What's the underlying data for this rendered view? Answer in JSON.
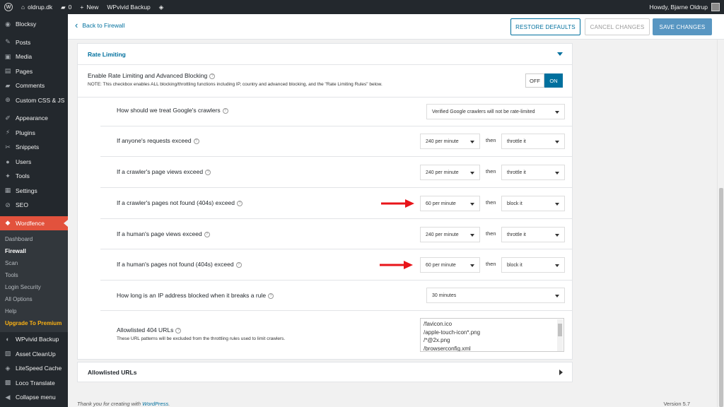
{
  "adminbar": {
    "site_name": "oldrup.dk",
    "comments_count": "0",
    "new_label": "New",
    "plugin_label": "WPvivid Backup",
    "howdy": "Howdy, Bjarne Oldrup"
  },
  "sidebar": {
    "items_top": [
      {
        "label": "Blocksy",
        "icon": "blocksy-icon"
      },
      {
        "label": "Posts",
        "icon": "pin-icon"
      },
      {
        "label": "Media",
        "icon": "media-icon"
      },
      {
        "label": "Pages",
        "icon": "pages-icon"
      },
      {
        "label": "Comments",
        "icon": "comment-icon"
      },
      {
        "label": "Custom CSS & JS",
        "icon": "plus-circle-icon"
      },
      {
        "label": "Appearance",
        "icon": "brush-icon"
      },
      {
        "label": "Plugins",
        "icon": "plug-icon"
      },
      {
        "label": "Snippets",
        "icon": "scissors-icon"
      },
      {
        "label": "Users",
        "icon": "user-icon"
      },
      {
        "label": "Tools",
        "icon": "wrench-icon"
      },
      {
        "label": "Settings",
        "icon": "sliders-icon"
      },
      {
        "label": "SEO",
        "icon": "seo-icon"
      }
    ],
    "active": {
      "label": "Wordfence",
      "icon": "wordfence-icon"
    },
    "submenu": [
      "Dashboard",
      "Firewall",
      "Scan",
      "Tools",
      "Login Security",
      "All Options",
      "Help",
      "Upgrade To Premium"
    ],
    "items_bottom": [
      {
        "label": "WPvivid Backup",
        "icon": "backup-icon"
      },
      {
        "label": "Asset CleanUp",
        "icon": "cleanup-icon"
      },
      {
        "label": "LiteSpeed Cache",
        "icon": "litespeed-icon"
      },
      {
        "label": "Loco Translate",
        "icon": "translate-icon"
      },
      {
        "label": "Collapse menu",
        "icon": "collapse-icon"
      }
    ]
  },
  "topbar": {
    "back_label": "Back to Firewall",
    "restore_label": "RESTORE DEFAULTS",
    "cancel_label": "CANCEL CHANGES",
    "save_label": "SAVE CHANGES"
  },
  "panel": {
    "title": "Rate Limiting",
    "enable_title": "Enable Rate Limiting and Advanced Blocking",
    "enable_note": "NOTE: This checkbox enables ALL blocking/throttling functions including IP, country and advanced blocking, and the \"Rate Limiting Rules\" below.",
    "toggle_off": "OFF",
    "toggle_on": "ON",
    "google_label": "How should we treat Google's crawlers",
    "google_value": "Verified Google crawlers will not be rate-limited",
    "then_label": "then",
    "rules": [
      {
        "label": "If anyone's requests exceed",
        "rate": "240 per minute",
        "action": "throttle it"
      },
      {
        "label": "If a crawler's page views exceed",
        "rate": "240 per minute",
        "action": "throttle it"
      },
      {
        "label": "If a crawler's pages not found (404s) exceed",
        "rate": "60 per minute",
        "action": "block it"
      },
      {
        "label": "If a human's page views exceed",
        "rate": "240 per minute",
        "action": "throttle it"
      },
      {
        "label": "If a human's pages not found (404s) exceed",
        "rate": "60 per minute",
        "action": "block it"
      }
    ],
    "block_duration_label": "How long is an IP address blocked when it breaks a rule",
    "block_duration_value": "30 minutes",
    "allowlisted_404_label": "Allowlisted 404 URLs",
    "allowlisted_404_note": "These URL patterns will be excluded from the throttling rules used to limit crawlers.",
    "allowlisted_404_lines": [
      "/favicon.ico",
      "/apple-touch-icon*.png",
      "/*@2x.png",
      "/browserconfig.xml"
    ]
  },
  "panel2": {
    "title": "Allowlisted URLs"
  },
  "footer": {
    "thanks": "Thank you for creating with",
    "wp_link": "WordPress",
    "version": "Version 5.7"
  },
  "colors": {
    "accent": "#00709e",
    "wordfence_red": "#e2523d",
    "arrow_red": "#e8141a",
    "save_blue": "#5896c2"
  }
}
